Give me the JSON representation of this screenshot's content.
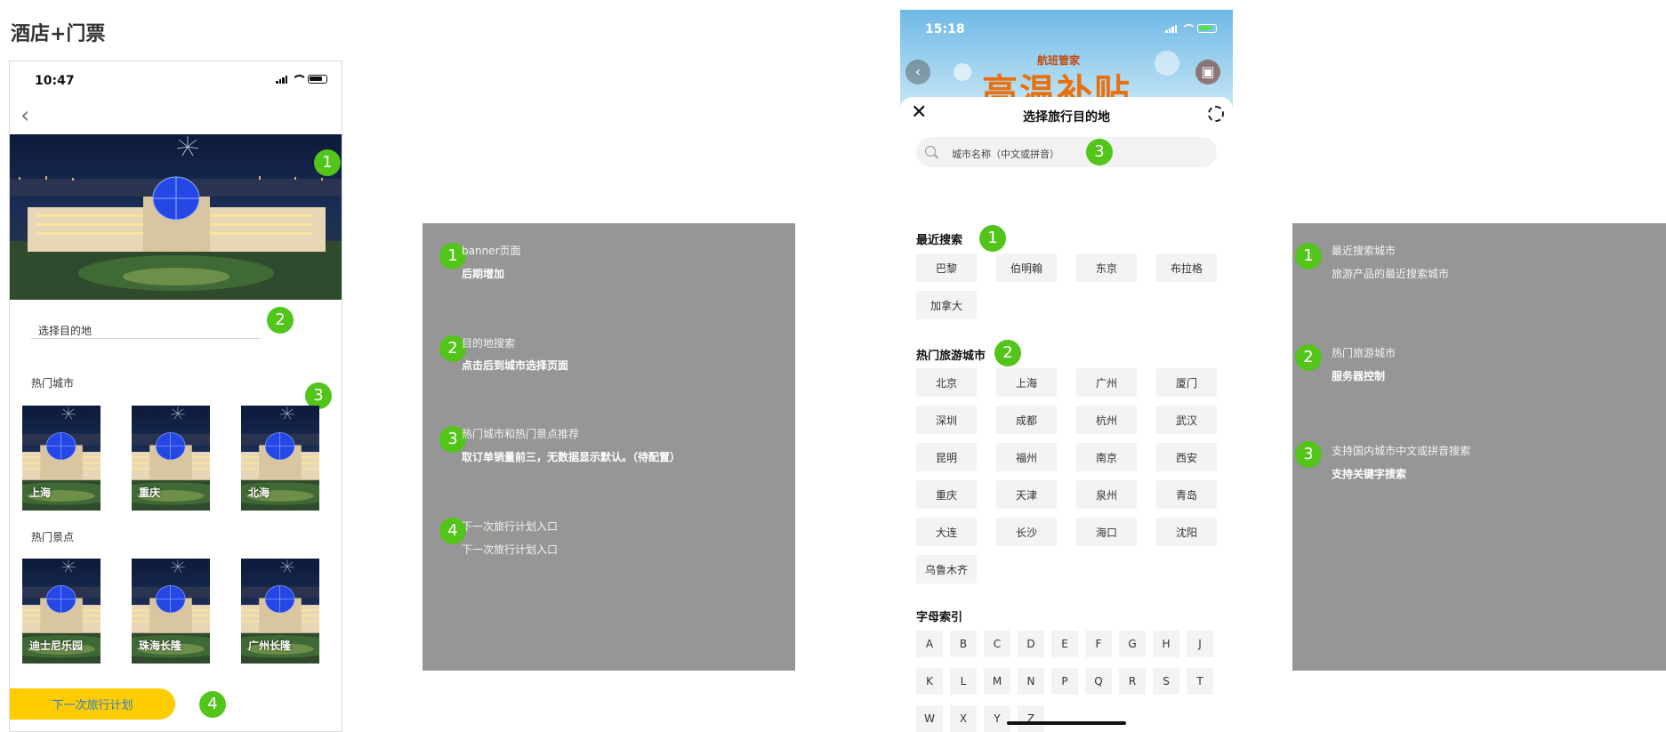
{
  "page_title": "酒店+门票",
  "left_phone": {
    "time": "10:47",
    "destination_placeholder": "选择目的地",
    "hot_cities_label": "热门城市",
    "hot_cities": [
      "上海",
      "重庆",
      "北海"
    ],
    "hot_spots_label": "热门景点",
    "hot_spots": [
      "迪士尼乐园",
      "珠海长隆",
      "广州长隆"
    ],
    "next_plan_button": "下一次旅行计划",
    "badges": [
      "1",
      "2",
      "3",
      "4"
    ]
  },
  "notes_left": [
    {
      "num": "1",
      "title": "banner页面",
      "body": "后期增加"
    },
    {
      "num": "2",
      "title": "目的地搜索",
      "body": "点击后到城市选择页面"
    },
    {
      "num": "3",
      "title": "热门城市和热门景点推荐",
      "body": "取订单销量前三，无数据显示默认。（待配置）"
    },
    {
      "num": "4",
      "title": "下一次旅行计划入口",
      "body": "下一次旅行计划入口"
    }
  ],
  "right_phone": {
    "time": "15:18",
    "banner_brand": "航班管家",
    "banner_promo": "高温补贴",
    "sheet_title": "选择旅行目的地",
    "search_placeholder": "城市名称（中文或拼音）",
    "recent_label": "最近搜索",
    "recent": [
      "巴黎",
      "伯明翰",
      "东京",
      "布拉格",
      "加拿大"
    ],
    "hot_label": "热门旅游城市",
    "hot": [
      "北京",
      "上海",
      "广州",
      "厦门",
      "深圳",
      "成都",
      "杭州",
      "武汉",
      "昆明",
      "福州",
      "南京",
      "西安",
      "重庆",
      "天津",
      "泉州",
      "青岛",
      "大连",
      "长沙",
      "海口",
      "沈阳",
      "乌鲁木齐"
    ],
    "index_label": "字母索引",
    "letters": [
      "A",
      "B",
      "C",
      "D",
      "E",
      "F",
      "G",
      "H",
      "J",
      "K",
      "L",
      "M",
      "N",
      "P",
      "Q",
      "R",
      "S",
      "T",
      "W",
      "X",
      "Y",
      "Z"
    ],
    "badges": [
      "1",
      "2",
      "3"
    ]
  },
  "notes_right": [
    {
      "num": "1",
      "title": "最近搜索城市",
      "body": "旅游产品的最近搜索城市"
    },
    {
      "num": "2",
      "title": "热门旅游城市",
      "body": "服务器控制"
    },
    {
      "num": "3",
      "title": "支持国内城市中文或拼音搜索",
      "body": "支持关键字搜索"
    }
  ],
  "colors": {
    "badge_green": "#52c41a",
    "panel_gray": "#969696",
    "cta_yellow": "#ffcc00",
    "cta_text_blue": "#2a7fd4",
    "promo_orange": "#e8710f"
  }
}
